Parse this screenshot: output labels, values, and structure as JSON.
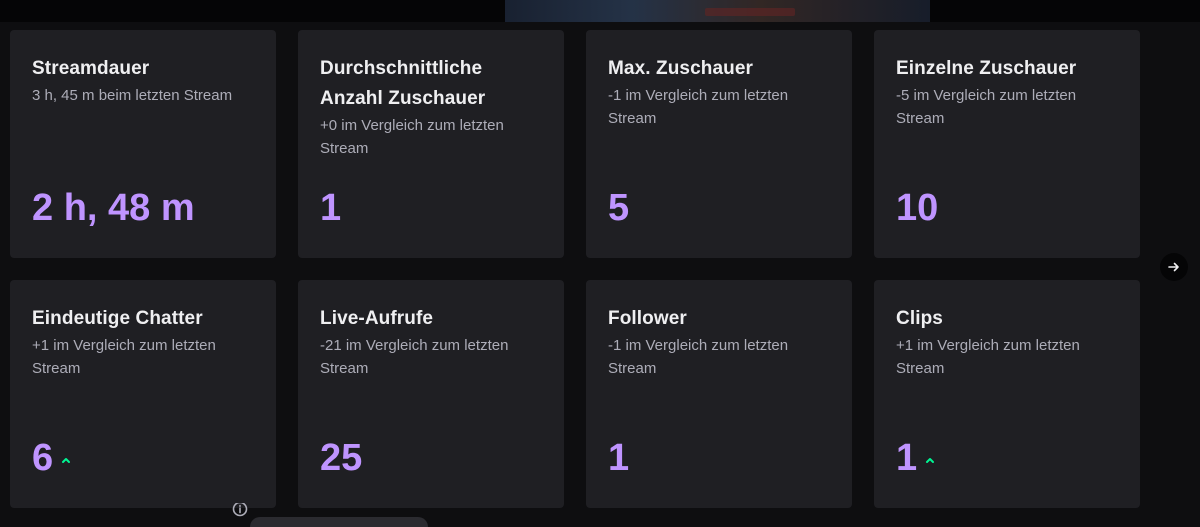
{
  "cards": [
    {
      "title": "Streamdauer",
      "subtitle": "3 h, 45 m beim letzten Stream",
      "value": "2 h, 48 m",
      "trend": "none"
    },
    {
      "title": "Durchschnittliche Anzahl Zuschauer",
      "subtitle": "+0 im Vergleich zum letzten Stream",
      "value": "1",
      "trend": "none"
    },
    {
      "title": "Max. Zuschauer",
      "subtitle": "-1 im Vergleich zum letzten Stream",
      "value": "5",
      "trend": "none"
    },
    {
      "title": "Einzelne Zuschauer",
      "subtitle": "-5 im Vergleich zum letzten Stream",
      "value": "10",
      "trend": "none"
    },
    {
      "title": "Eindeutige Chatter",
      "subtitle": "+1 im Vergleich zum letzten Stream",
      "value": "6",
      "trend": "up"
    },
    {
      "title": "Live-Aufrufe",
      "subtitle": "-21 im Vergleich zum letzten Stream",
      "value": "25",
      "trend": "none"
    },
    {
      "title": "Follower",
      "subtitle": "-1 im Vergleich zum letzten Stream",
      "value": "1",
      "trend": "none"
    },
    {
      "title": "Clips",
      "subtitle": "+1 im Vergleich zum letzten Stream",
      "value": "1",
      "trend": "up"
    }
  ],
  "colors": {
    "background": "#0e0e10",
    "card": "#1f1f23",
    "value": "#bf94ff",
    "trend_up": "#00f593",
    "subtitle": "#adadb8"
  },
  "icons": {
    "next": "arrow-right-icon",
    "trend_up": "chevron-up-icon",
    "footer": "info-icon"
  }
}
